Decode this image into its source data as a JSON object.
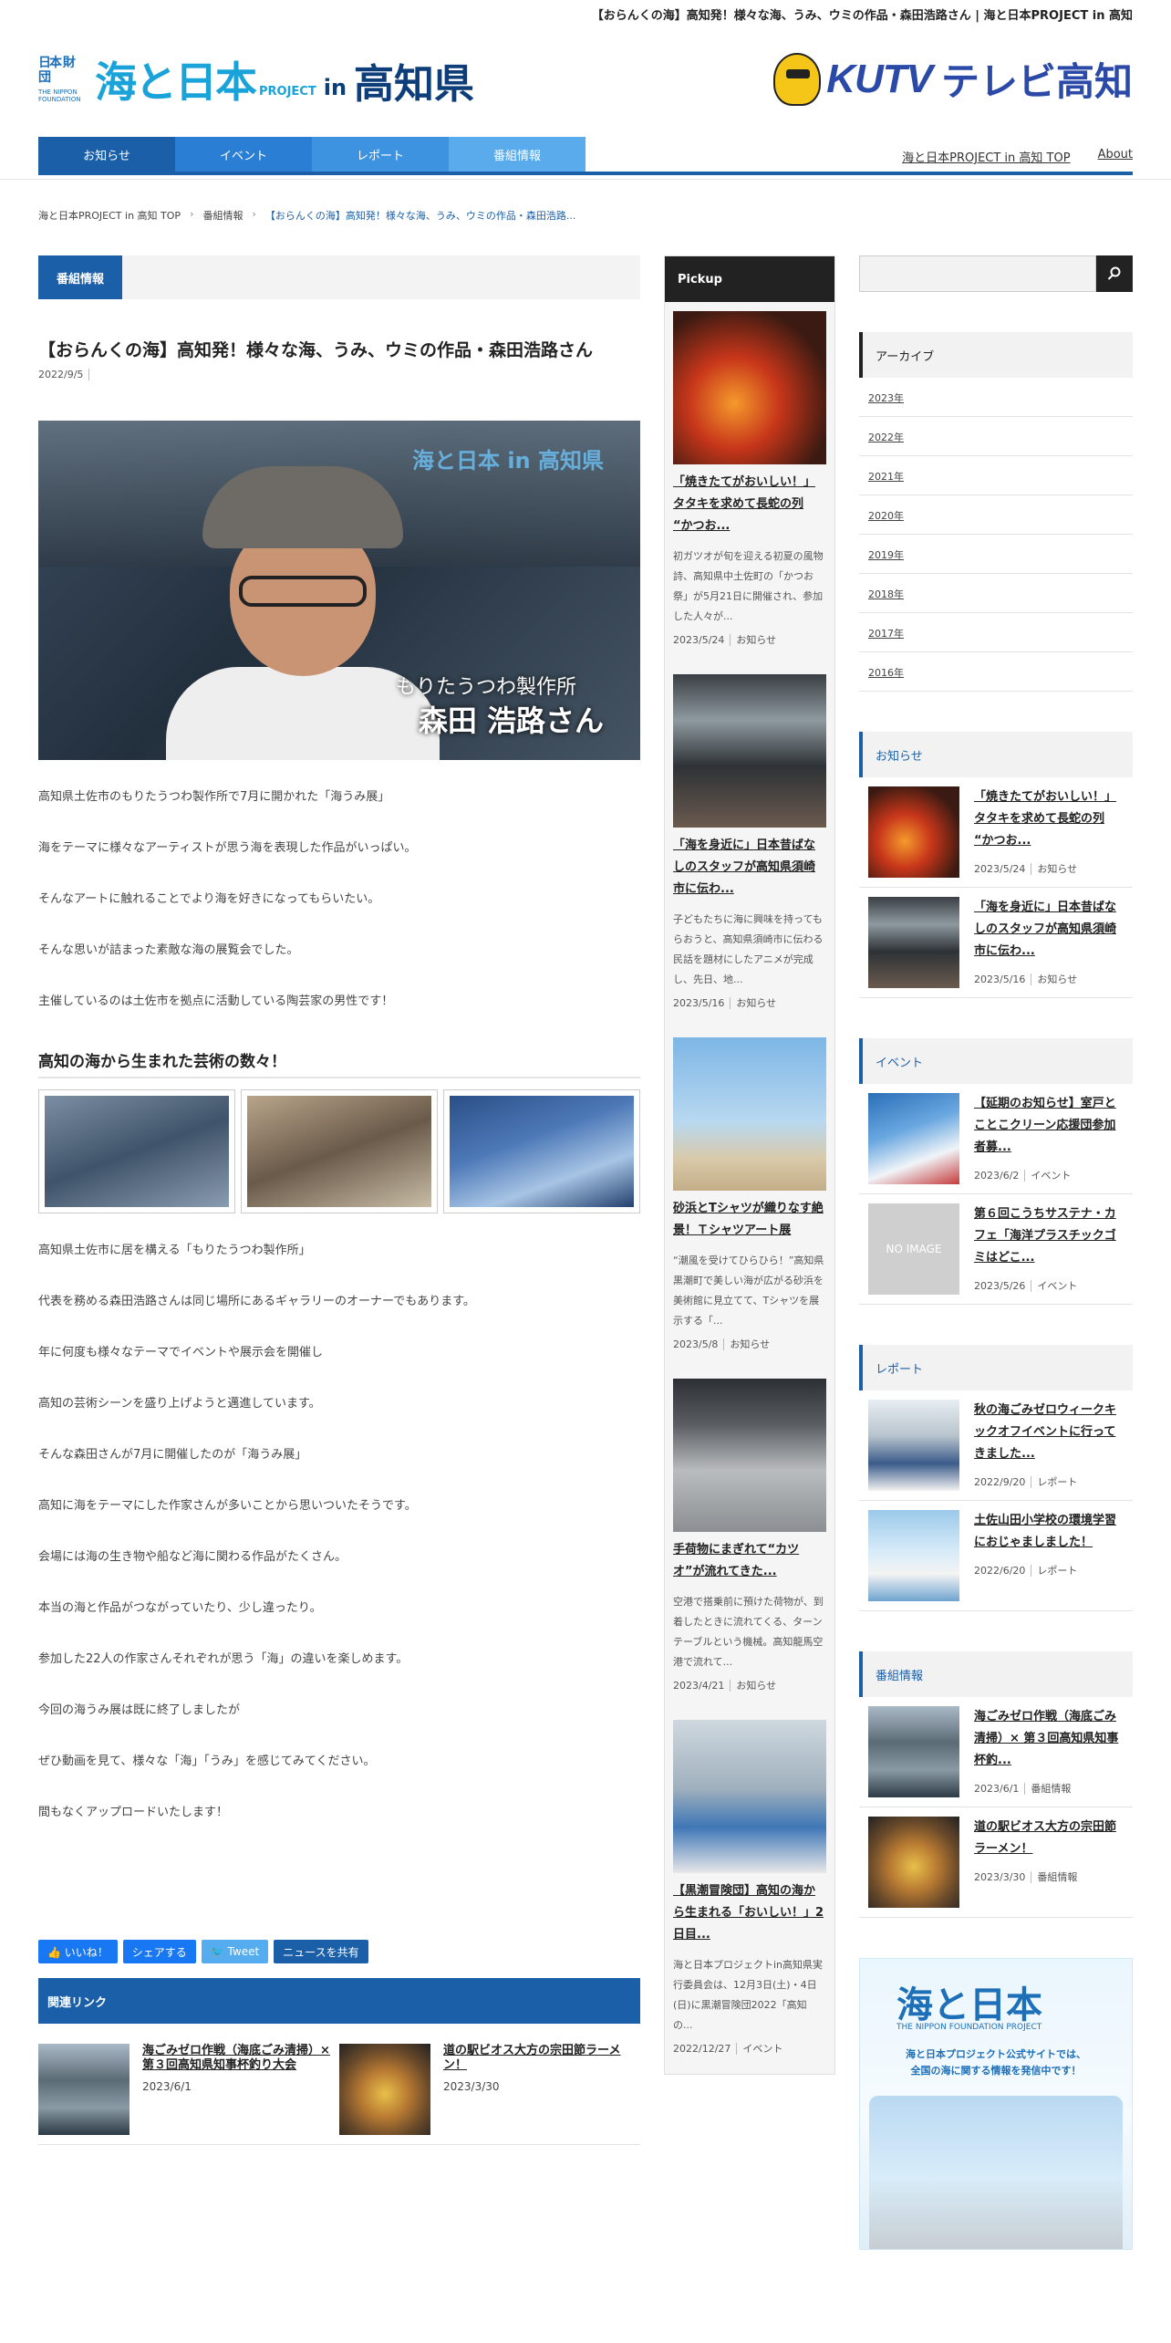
{
  "page_title": "【おらんくの海】高知発！様々な海、うみ、ウミの作品・森田浩路さん | 海と日本PROJECT in 高知",
  "header": {
    "nf_small": "日本 財団",
    "nf_en": "THE NIPPON FOUNDATION",
    "umi_logo": "海と日本",
    "project": "PROJECT",
    "in": "in",
    "kochi": "高知県",
    "kutv": "KUTV",
    "tv_kochi": "テレビ高知"
  },
  "nav": {
    "items": [
      {
        "label": "お知らせ",
        "color": "#1a5fa8"
      },
      {
        "label": "イベント",
        "color": "#2a7fd4"
      },
      {
        "label": "レポート",
        "color": "#3d93e0"
      },
      {
        "label": "番組情報",
        "color": "#5aabec"
      }
    ],
    "right": [
      "海と日本PROJECT in 高知 TOP",
      "About"
    ]
  },
  "breadcrumb": {
    "home": "海と日本PROJECT in 高知 TOP",
    "category": "番組情報",
    "current": "【おらんくの海】高知発！様々な海、うみ、ウミの作品・森田浩路..."
  },
  "main": {
    "category_label": "番組情報",
    "title": "【おらんくの海】高知発！様々な海、うみ、ウミの作品・森田浩路さん",
    "date": "2022/9/5",
    "hero": {
      "overlay_logo": "海と日本 in 高知県",
      "overlay_sub": "もりたうつわ製作所",
      "overlay_name": "森田 浩路さん"
    },
    "paras_a": [
      "高知県土佐市のもりたうつわ製作所で7月に開かれた「海うみ展」",
      "海をテーマに様々なアーティストが思う海を表現した作品がいっぱい。",
      "そんなアートに触れることでより海を好きになってもらいたい。",
      "そんな思いが詰まった素敵な海の展覧会でした。",
      "主催しているのは土佐市を拠点に活動している陶芸家の男性です！"
    ],
    "h2": "高知の海から生まれた芸術の数々！",
    "paras_b": [
      "高知県土佐市に居を構える「もりたうつわ製作所」",
      "代表を務める森田浩路さんは同じ場所にあるギャラリーのオーナーでもあります。",
      "年に何度も様々なテーマでイベントや展示会を開催し",
      "高知の芸術シーンを盛り上げようと邁進しています。",
      "そんな森田さんが7月に開催したのが「海うみ展」",
      "高知に海をテーマにした作家さんが多いことから思いついたそうです。",
      "会場には海の生き物や船など海に関わる作品がたくさん。",
      "本当の海と作品がつながっていたり、少し違ったり。",
      "参加した22人の作家さんそれぞれが思う「海」の違いを楽しめます。",
      "今回の海うみ展は既に終了しましたが",
      "ぜひ動画を見て、様々な「海」「うみ」を感じてみてください。",
      "間もなくアップロードいたします！"
    ],
    "share": [
      {
        "label": "👍 いいね！",
        "color": "#1877f2"
      },
      {
        "label": "シェアする",
        "color": "#1877f2"
      },
      {
        "label": "🐦 Tweet",
        "color": "#55acee"
      },
      {
        "label": "ニュースを共有",
        "color": "#1a5fa8"
      }
    ],
    "related_head": "関連リンク",
    "related": [
      {
        "title": "海ごみゼロ作戦（海底ごみ清掃）× 第３回高知県知事杯釣り大会",
        "date": "2023/6/1"
      },
      {
        "title": "道の駅ビオス大方の宗田節ラーメン！",
        "date": "2023/3/30"
      }
    ]
  },
  "pickup": {
    "head": "Pickup",
    "items": [
      {
        "title": "「焼きたてがおいしい！」タタキを求めて長蛇の列 “かつお...",
        "desc": "初ガツオが旬を迎える初夏の風物詩、高知県中土佐町の「かつお祭」が5月21日に開催され、参加した人々が...",
        "date": "2023/5/24",
        "cat": "お知らせ"
      },
      {
        "title": "「海を身近に」日本昔ばなしのスタッフが高知県須崎市に伝わ...",
        "desc": "子どもたちに海に興味を持ってもらおうと、高知県須崎市に伝わる民話を題材にしたアニメが完成し、先日、地...",
        "date": "2023/5/16",
        "cat": "お知らせ"
      },
      {
        "title": "砂浜とTシャツが織りなす絶景！Ｔシャツアート展",
        "desc": "“潮風を受けてひらひら！”高知県黒潮町で美しい海が広がる砂浜を美術館に見立てて、Tシャツを展示する「...",
        "date": "2023/5/8",
        "cat": "お知らせ"
      },
      {
        "title": "手荷物にまぎれて“カツオ”が流れてきた...",
        "desc": "空港で搭乗前に預けた荷物が、到着したときに流れてくる、ターンテーブルという機械。高知龍馬空港で流れて...",
        "date": "2023/4/21",
        "cat": "お知らせ"
      },
      {
        "title": "【黒潮冒険団】高知の海から生まれる「おいしい！」2日目...",
        "desc": "海と日本プロジェクトin高知県実行委員会は、12月3日(土)・4日(日)に黒潮冒険団2022「高知の...",
        "date": "2022/12/27",
        "cat": "イベント"
      }
    ]
  },
  "side": {
    "search_placeholder": "",
    "archive_head": "アーカイブ",
    "archive": [
      "2023年",
      "2022年",
      "2021年",
      "2020年",
      "2019年",
      "2018年",
      "2017年",
      "2016年"
    ],
    "oshirase_head": "お知らせ",
    "oshirase": [
      {
        "title": "「焼きたてがおいしい！」タタキを求めて長蛇の列 “かつお...",
        "date": "2023/5/24",
        "cat": "お知らせ"
      },
      {
        "title": "「海を身近に」日本昔ばなしのスタッフが高知県須崎市に伝わ...",
        "date": "2023/5/16",
        "cat": "お知らせ"
      }
    ],
    "event_head": "イベント",
    "event": [
      {
        "title": "【延期のお知らせ】室戸とことこクリーン応援団参加者募...",
        "date": "2023/6/2",
        "cat": "イベント"
      },
      {
        "title": "第６回こうちサステナ・カフェ「海洋プラスチックゴミはどこ...",
        "date": "2023/5/26",
        "cat": "イベント",
        "noimg": "NO IMAGE"
      }
    ],
    "report_head": "レポート",
    "report": [
      {
        "title": "秋の海ごみゼロウィークキックオフイベントに行ってきました...",
        "date": "2022/9/20",
        "cat": "レポート"
      },
      {
        "title": "土佐山田小学校の環境学習におじゃましました！",
        "date": "2022/6/20",
        "cat": "レポート"
      }
    ],
    "program_head": "番組情報",
    "program": [
      {
        "title": "海ごみゼロ作戦（海底ごみ清掃）× 第３回高知県知事杯釣...",
        "date": "2023/6/1",
        "cat": "番組情報"
      },
      {
        "title": "道の駅ビオス大方の宗田節ラーメン！",
        "date": "2023/3/30",
        "cat": "番組情報"
      }
    ],
    "banner": {
      "logo": "海と日本",
      "nf": "THE NIPPON FOUNDATION PROJECT",
      "text": "海と日本プロジェクト公式サイトでは、\n全国の海に関する情報を発信中です！"
    }
  }
}
